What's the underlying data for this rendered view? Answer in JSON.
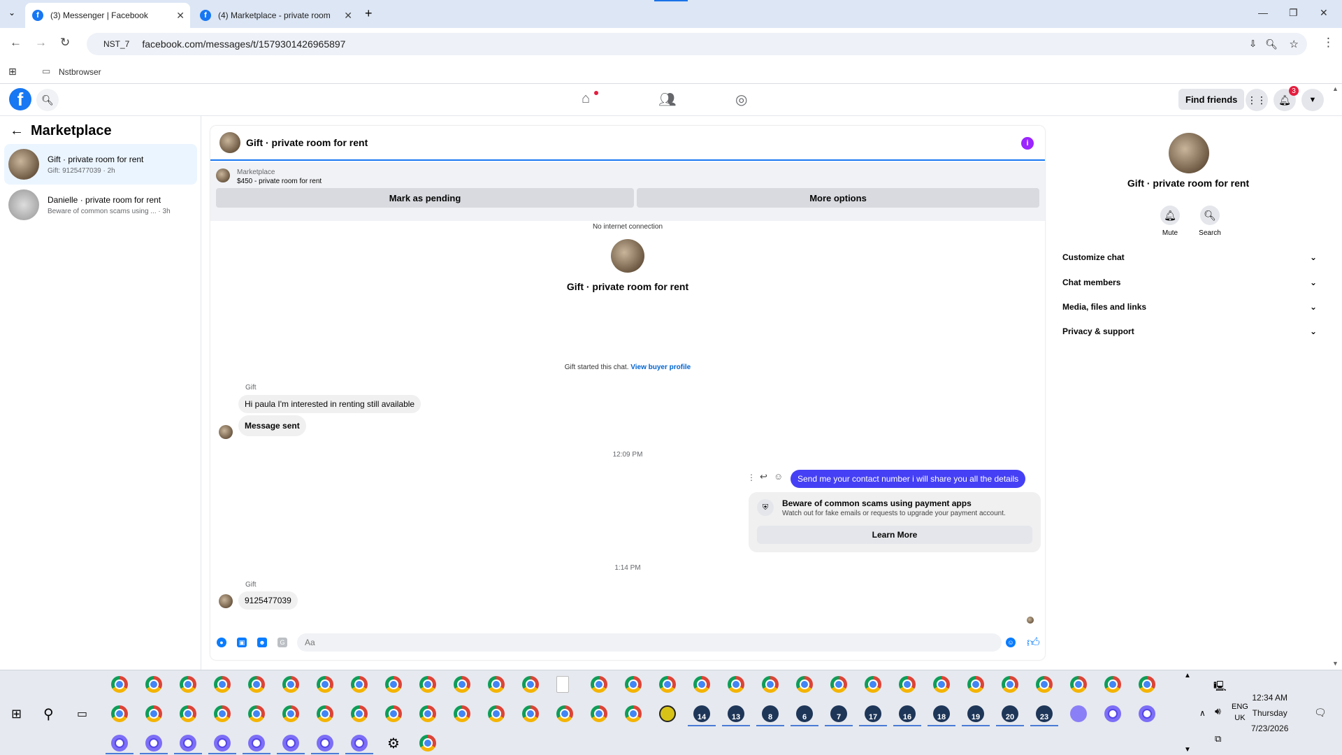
{
  "browser": {
    "tabs": [
      {
        "title": "(3) Messenger | Facebook",
        "active": true
      },
      {
        "title": "(4) Marketplace - private room"
      }
    ],
    "profile_chip": "NST_7",
    "url": "facebook.com/messages/t/1579301426965897",
    "bookmark_folder": "Nstbrowser"
  },
  "fb": {
    "find_friends": "Find friends",
    "notifications_count": "3"
  },
  "left": {
    "title": "Marketplace",
    "conversations": [
      {
        "name": "Gift · private room for rent",
        "preview": "Gift: 9125477039 · 2h"
      },
      {
        "name": "Danielle · private room for rent",
        "preview": "Beware of common scams using ... · 3h"
      }
    ]
  },
  "chat": {
    "header_name": "Gift · private room for rent",
    "marketplace_label": "Marketplace",
    "listing": "$450 - private room for rent",
    "mark_pending": "Mark as pending",
    "more_options": "More options",
    "no_internet": "No internet connection",
    "center_name": "Gift · private room for rent",
    "started_text": "Gift started this chat.",
    "view_buyer": "View buyer profile",
    "sender1": "Gift",
    "msg1": "Hi paula I'm interested in renting still available",
    "msg2": "Message sent",
    "time1": "12:09 PM",
    "my_msg": "Send me your contact number i will share you all the details",
    "scam_title": "Beware of common scams using payment apps",
    "scam_desc": "Watch out for fake emails or requests to upgrade your payment account.",
    "learn_more": "Learn More",
    "time2": "1:14 PM",
    "sender2": "Gift",
    "msg3": "9125477039",
    "composer_placeholder": "Aa"
  },
  "right": {
    "name": "Gift · private room for rent",
    "mute": "Mute",
    "search": "Search",
    "sections": [
      "Customize chat",
      "Chat members",
      "Media, files and links",
      "Privacy & support"
    ]
  },
  "taskbar": {
    "badges": [
      "14",
      "13",
      "8",
      "6",
      "7",
      "17",
      "16",
      "18",
      "19",
      "20",
      "23"
    ],
    "lang1": "ENG",
    "lang2": "UK",
    "time": "12:34 AM",
    "day": "Thursday",
    "date": "7/23/2026"
  },
  "colors": {
    "fb_blue": "#1877f2",
    "my_bubble": "#4540f5",
    "info_purple": "#9b24ff"
  }
}
